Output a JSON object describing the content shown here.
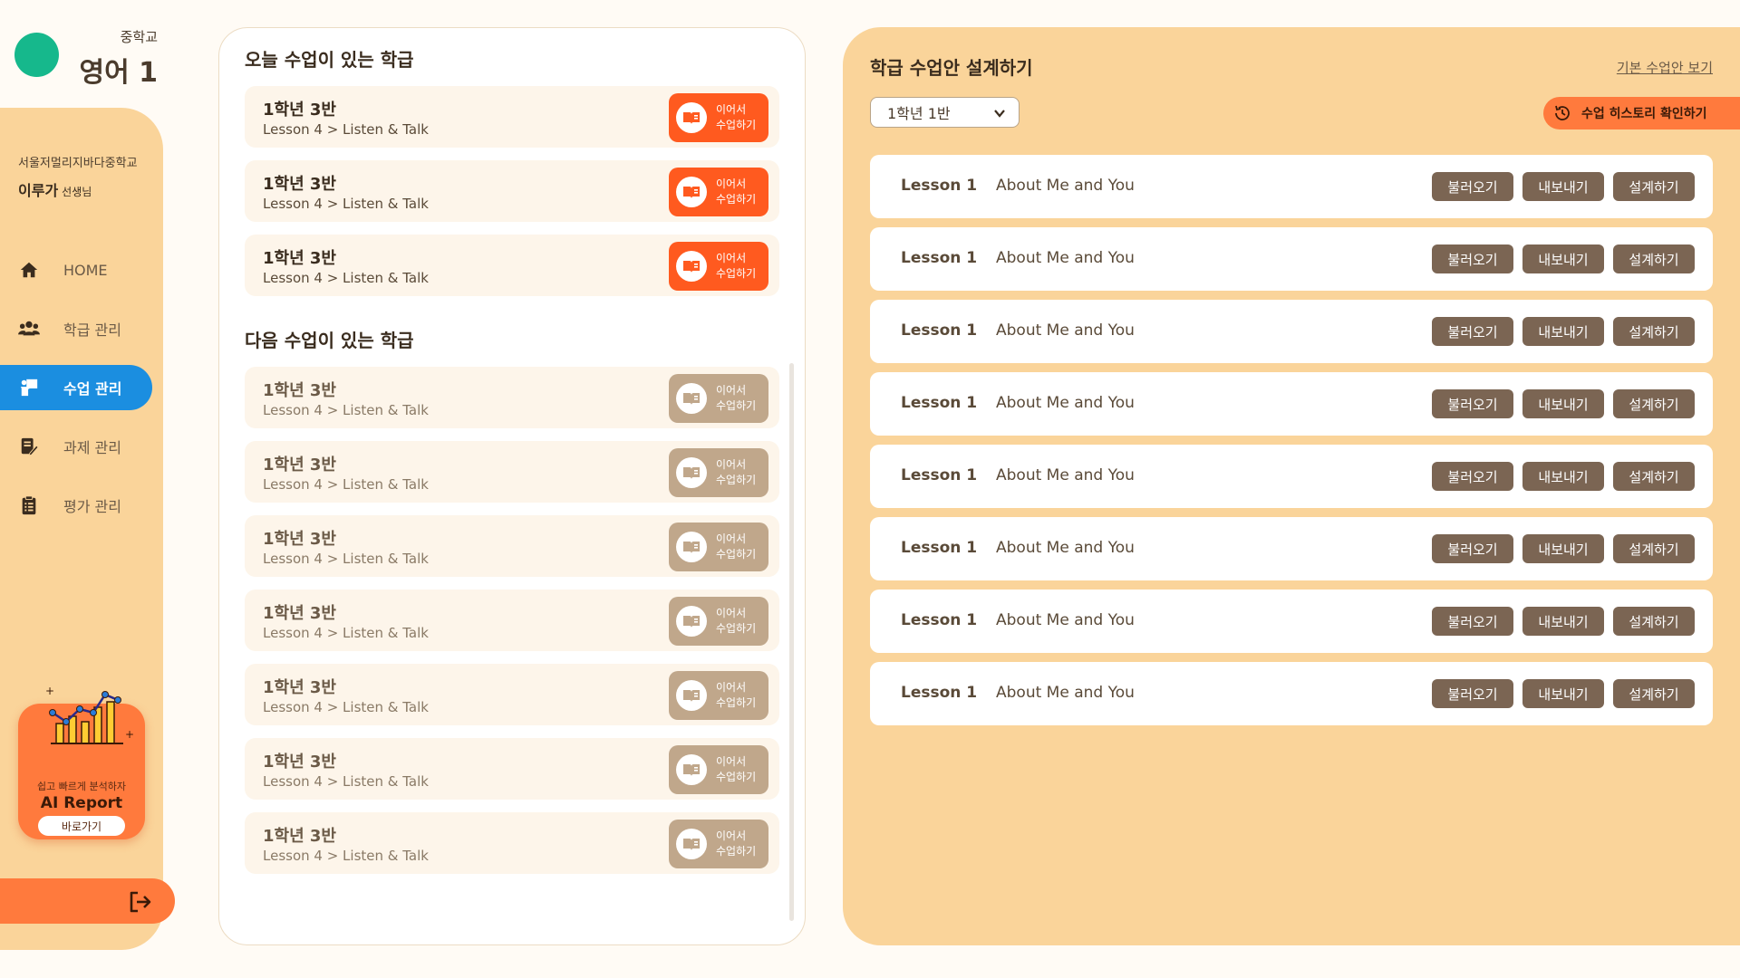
{
  "brand": {
    "school_level": "중학교",
    "subject": "영어 1"
  },
  "profile": {
    "school": "서울저멀리지바다중학교",
    "name": "이루가",
    "suffix": "선생님"
  },
  "nav": [
    {
      "label": "HOME",
      "icon": "home-icon",
      "active": false
    },
    {
      "label": "학급 관리",
      "icon": "users-icon",
      "active": false
    },
    {
      "label": "수업 관리",
      "icon": "teacher-board-icon",
      "active": true
    },
    {
      "label": "과제 관리",
      "icon": "edit-note-icon",
      "active": false
    },
    {
      "label": "평가 관리",
      "icon": "clipboard-icon",
      "active": false
    }
  ],
  "ai_report": {
    "tagline": "쉽고 빠르게 분석하자",
    "title": "AI Report",
    "button": "바로가기"
  },
  "today": {
    "title": "오늘 수업이 있는 학급",
    "classes": [
      {
        "name": "1학년 3반",
        "path": "Lesson 4 > Listen & Talk"
      },
      {
        "name": "1학년 3반",
        "path": "Lesson 4 > Listen & Talk"
      },
      {
        "name": "1학년 3반",
        "path": "Lesson 4 > Listen & Talk"
      }
    ]
  },
  "next": {
    "title": "다음 수업이 있는 학급",
    "classes": [
      {
        "name": "1학년 3반",
        "path": "Lesson 4 > Listen & Talk"
      },
      {
        "name": "1학년 3반",
        "path": "Lesson 4 > Listen & Talk"
      },
      {
        "name": "1학년 3반",
        "path": "Lesson 4 > Listen & Talk"
      },
      {
        "name": "1학년 3반",
        "path": "Lesson 4 > Listen & Talk"
      },
      {
        "name": "1학년 3반",
        "path": "Lesson 4 > Listen & Talk"
      },
      {
        "name": "1학년 3반",
        "path": "Lesson 4 > Listen & Talk"
      },
      {
        "name": "1학년 3반",
        "path": "Lesson 4 > Listen & Talk"
      }
    ]
  },
  "resume_button": {
    "line1": "이어서",
    "line2": "수업하기"
  },
  "design": {
    "title": "학급 수업안 설계하기",
    "default_link": "기본 수업안 보기",
    "selected_class": "1학년 1반",
    "history_button": "수업 히스토리 확인하기",
    "actions": {
      "load": "불러오기",
      "export": "내보내기",
      "design": "설계하기"
    },
    "lessons": [
      {
        "number": "Lesson 1",
        "title": "About Me and You"
      },
      {
        "number": "Lesson 1",
        "title": "About Me and You"
      },
      {
        "number": "Lesson 1",
        "title": "About Me and You"
      },
      {
        "number": "Lesson 1",
        "title": "About Me and You"
      },
      {
        "number": "Lesson 1",
        "title": "About Me and You"
      },
      {
        "number": "Lesson 1",
        "title": "About Me and You"
      },
      {
        "number": "Lesson 1",
        "title": "About Me and You"
      },
      {
        "number": "Lesson 1",
        "title": "About Me and You"
      }
    ]
  },
  "colors": {
    "accent_orange": "#ff5a1f",
    "panel_peach": "#fad49a",
    "active_blue": "#1b8ee0",
    "brand_green": "#16b88c",
    "action_brown": "#7b6553",
    "muted_button": "#c0a78b"
  }
}
